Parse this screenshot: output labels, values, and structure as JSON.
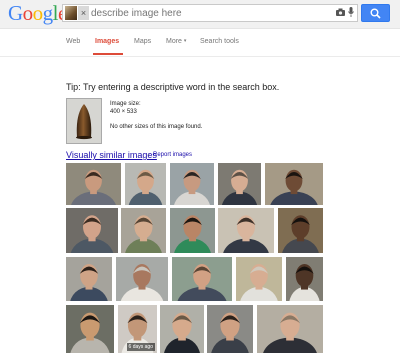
{
  "header": {
    "logo": [
      "G",
      "o",
      "o",
      "g",
      "l",
      "e"
    ],
    "logo_colors": [
      "#4285f4",
      "#ea4335",
      "#fbbc05",
      "#4285f4",
      "#34a853",
      "#ea4335"
    ],
    "search_placeholder": "describe image here",
    "remove_image_glyph": "×",
    "icons": [
      "camera-icon",
      "mic-icon",
      "search-icon"
    ]
  },
  "nav": {
    "tabs": [
      {
        "label": "Web",
        "active": false
      },
      {
        "label": "Images",
        "active": true
      },
      {
        "label": "Maps",
        "active": false
      },
      {
        "label": "More",
        "active": false,
        "caret": "▾"
      },
      {
        "label": "Search tools",
        "active": false
      }
    ]
  },
  "result": {
    "tip": "Tip: Try entering a descriptive word in the search box.",
    "image_size_label": "Image size:",
    "image_size_value": "400 × 533",
    "no_other_sizes": "No other sizes of this image found.",
    "similar_link": "Visually similar images",
    "separator": "-",
    "report_link": "Report images"
  },
  "grid": {
    "tiles": [
      {
        "bg": "#8f8a7c",
        "shirt": "#6a6e7a",
        "skin": "#c99a7e",
        "hair": "#3a2a20"
      },
      {
        "bg": "#b8b9b4",
        "shirt": "#50606e",
        "skin": "#d4a88a",
        "hair": "#6b5a45"
      },
      {
        "bg": "#9aa3a6",
        "shirt": "#d8d6d2",
        "skin": "#c79a80",
        "hair": "#2a2522"
      },
      {
        "bg": "#7d7a72",
        "shirt": "#2e3440",
        "skin": "#d6ad93",
        "hair": "#5c5046"
      },
      {
        "bg": "#a59a86",
        "shirt": "#394154",
        "skin": "#6e4b35",
        "hair": "#1a1410"
      },
      {
        "bg": "#6f6c67",
        "shirt": "#4d5864",
        "skin": "#d2a38a",
        "hair": "#3b2c22"
      },
      {
        "bg": "#a8a398",
        "shirt": "#6e7f58",
        "skin": "#d5ad90",
        "hair": "#574636"
      },
      {
        "bg": "#8d9791",
        "shirt": "#2f8b5a",
        "skin": "#b98566",
        "hair": "#1d1712"
      },
      {
        "bg": "#c9c2b4",
        "shirt": "#333945",
        "skin": "#d9b59d",
        "hair": "#3d3129"
      },
      {
        "bg": "#7f6d52",
        "shirt": "#45484f",
        "skin": "#5d3e2a",
        "hair": "#15110e"
      },
      {
        "bg": "#a5a39c",
        "shirt": "#3c4a5f",
        "skin": "#cfa386",
        "hair": "#2c2019"
      },
      {
        "bg": "#a7aaa7",
        "shirt": "#e9e6e0",
        "skin": "#a8785f",
        "hair": "#c9c5bd"
      },
      {
        "bg": "#8c9e8f",
        "shirt": "#424b5c",
        "skin": "#d2a184",
        "hair": "#5a4636"
      },
      {
        "bg": "#bfb79a",
        "shirt": "#e2e1dc",
        "skin": "#d7ad92",
        "hair": "#d0c9bc"
      },
      {
        "bg": "#807d73",
        "shirt": "#e5e3dd",
        "skin": "#4e3526",
        "hair": "#15110e"
      },
      {
        "bg": "#6c6e64",
        "shirt": "#b8b5ad",
        "skin": "#c99a70",
        "hair": "#1b1612"
      },
      {
        "bg": "#cfcac4",
        "shirt": "#eceae5",
        "skin": "#c29778",
        "hair": "#2b211a",
        "label": "6 days ago"
      },
      {
        "bg": "#b0b0a8",
        "shirt": "#1f242c",
        "skin": "#d6aa8c",
        "hair": "#6a5947"
      },
      {
        "bg": "#8a8a86",
        "shirt": "#3a3f48",
        "skin": "#d0a183",
        "hair": "#2b221c"
      },
      {
        "bg": "#b4aea2",
        "shirt": "#2d2f36",
        "skin": "#d7ad92",
        "hair": "#8a7865"
      }
    ]
  }
}
